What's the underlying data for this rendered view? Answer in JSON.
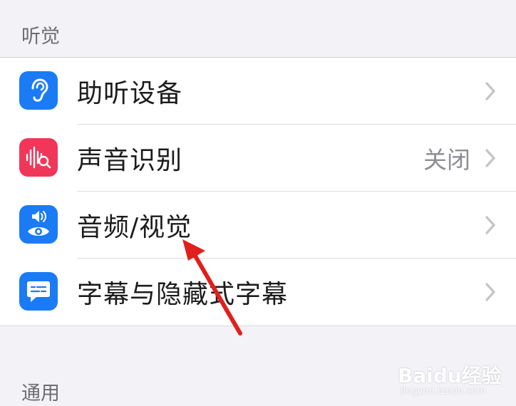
{
  "sections": {
    "hearing_header": "听觉",
    "general_header": "通用"
  },
  "rows": [
    {
      "label": "助听设备",
      "value": "",
      "icon": "ear-icon",
      "icon_color": "#1a7bf5"
    },
    {
      "label": "声音识别",
      "value": "关闭",
      "icon": "sound-recognition-icon",
      "icon_color": "#f0375a"
    },
    {
      "label": "音频/视觉",
      "value": "",
      "icon": "audio-visual-icon",
      "icon_color": "#1a7bf5"
    },
    {
      "label": "字幕与隐藏式字幕",
      "value": "",
      "icon": "captions-icon",
      "icon_color": "#1a7bf5"
    }
  ],
  "annotation": {
    "arrow_color": "#e0201c"
  },
  "watermark": {
    "main": "Baidu经验",
    "sub": "jingyan.baidu.com"
  }
}
